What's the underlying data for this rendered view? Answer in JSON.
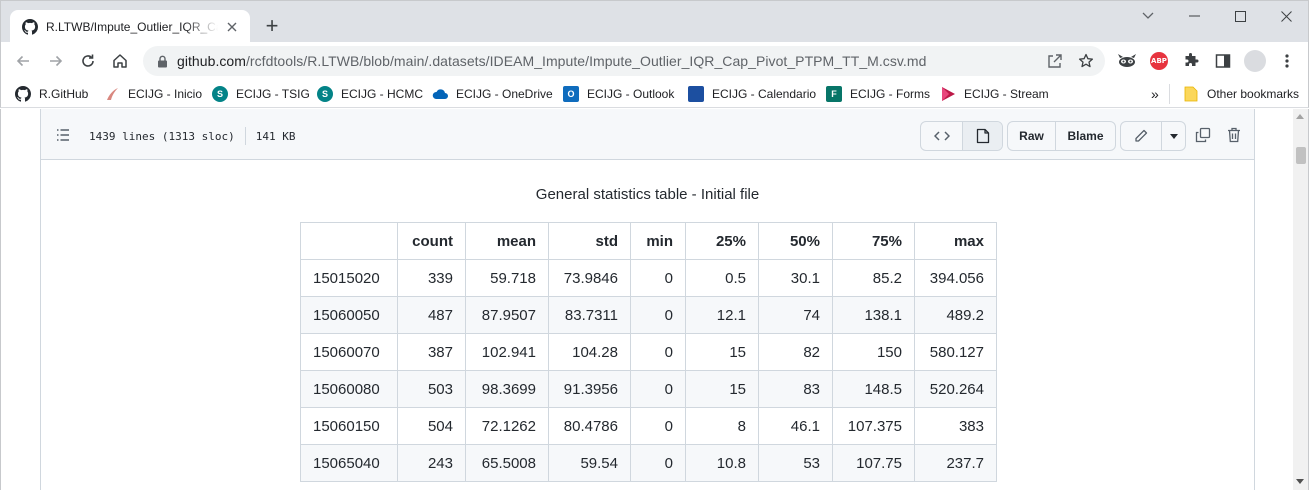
{
  "browser": {
    "tab": {
      "title": "R.LTWB/Impute_Outlier_IQR_Cap_Pivot_PTPM_TT_M.csv.md",
      "favicon": "github-icon"
    },
    "new_tab_label": "+",
    "url": {
      "host": "github.com",
      "path": "/rcfdtools/R.LTWB/blob/main/.datasets/IDEAM_Impute/Impute_Outlier_IQR_Cap_Pivot_PTPM_TT_M.csv.md"
    },
    "extensions": {
      "abp_label": "ABP"
    }
  },
  "bookmarks": {
    "items": [
      {
        "label": "R.GitHub",
        "icon": "github-icon",
        "color": "#24292f"
      },
      {
        "label": "ECIJG - Inicio",
        "icon": "ecijg-logo-icon",
        "color": "#b03a2e"
      },
      {
        "label": "ECIJG - TSIG",
        "icon": "sharepoint-icon",
        "color": "#038387"
      },
      {
        "label": "ECIJG - HCMC",
        "icon": "sharepoint-icon",
        "color": "#038387"
      },
      {
        "label": "ECIJG - OneDrive",
        "icon": "onedrive-icon",
        "color": "#0364b8"
      },
      {
        "label": "ECIJG - Outlook",
        "icon": "outlook-icon",
        "color": "#0f6cbd"
      },
      {
        "label": "ECIJG - Calendario",
        "icon": "calendar-icon",
        "color": "#1c4fa0"
      },
      {
        "label": "ECIJG - Forms",
        "icon": "forms-icon",
        "color": "#077568"
      },
      {
        "label": "ECIJG - Stream",
        "icon": "stream-icon",
        "color": "#bc1948"
      }
    ],
    "overflow_label": "»",
    "other_label": "Other bookmarks"
  },
  "file": {
    "lines": "1439 lines (1313 sloc)",
    "size": "141 KB",
    "raw_label": "Raw",
    "blame_label": "Blame"
  },
  "table": {
    "caption": "General statistics table - Initial file",
    "headers": [
      "",
      "count",
      "mean",
      "std",
      "min",
      "25%",
      "50%",
      "75%",
      "max"
    ],
    "rows": [
      [
        "15015020",
        "339",
        "59.718",
        "73.9846",
        "0",
        "0.5",
        "30.1",
        "85.2",
        "394.056"
      ],
      [
        "15060050",
        "487",
        "87.9507",
        "83.7311",
        "0",
        "12.1",
        "74",
        "138.1",
        "489.2"
      ],
      [
        "15060070",
        "387",
        "102.941",
        "104.28",
        "0",
        "15",
        "82",
        "150",
        "580.127"
      ],
      [
        "15060080",
        "503",
        "98.3699",
        "91.3956",
        "0",
        "15",
        "83",
        "148.5",
        "520.264"
      ],
      [
        "15060150",
        "504",
        "72.1262",
        "80.4786",
        "0",
        "8",
        "46.1",
        "107.375",
        "383"
      ],
      [
        "15065040",
        "243",
        "65.5008",
        "59.54",
        "0",
        "10.8",
        "53",
        "107.75",
        "237.7"
      ]
    ]
  }
}
